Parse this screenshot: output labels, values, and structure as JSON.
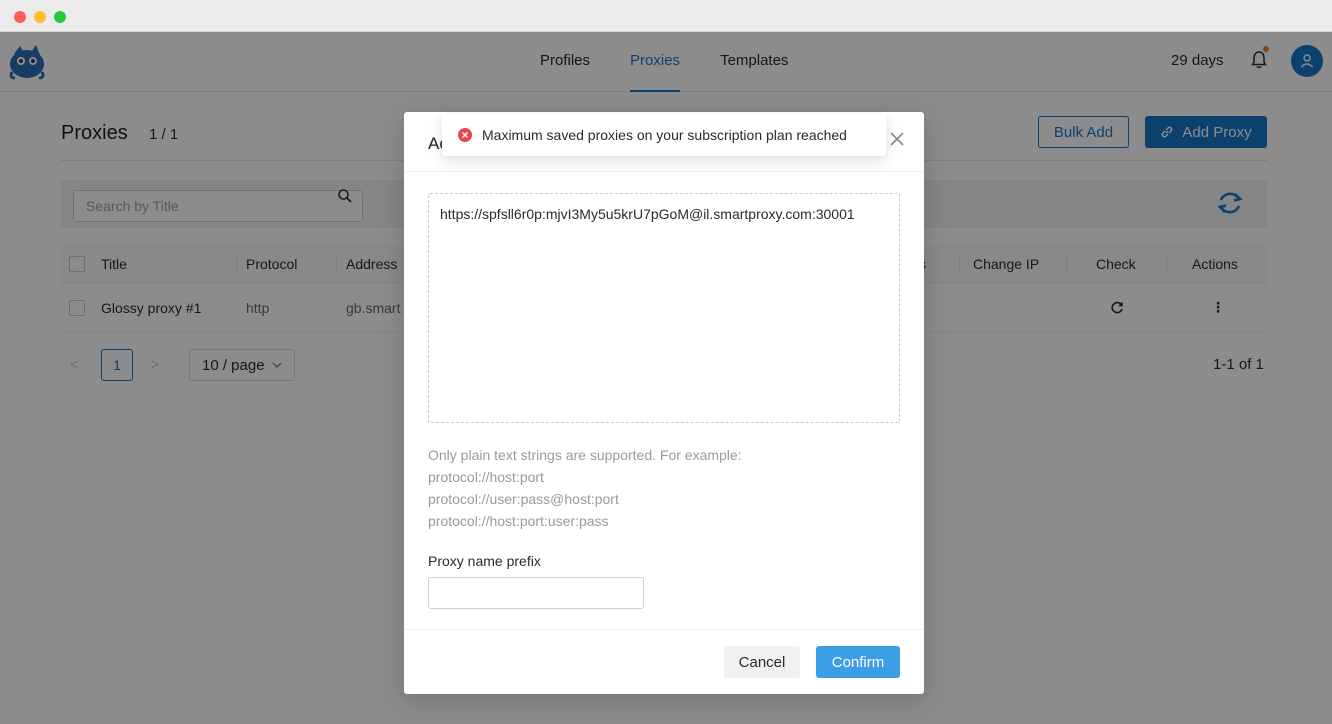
{
  "app": {
    "nav": {
      "links": [
        {
          "label": "Profiles"
        },
        {
          "label": "Proxies"
        },
        {
          "label": "Templates"
        }
      ],
      "subscription_days": "29 days"
    },
    "page": {
      "title": "Proxies",
      "count": "1 / 1",
      "bulk_add_label": "Bulk Add",
      "add_proxy_label": "Add Proxy",
      "search_placeholder": "Search by Title"
    },
    "table": {
      "headers": {
        "title": "Title",
        "protocol": "Protocol",
        "address": "Address",
        "hidden_col_tail": "s",
        "change_ip": "Change IP",
        "check": "Check",
        "actions": "Actions"
      },
      "rows": [
        {
          "title": "Glossy proxy #1",
          "protocol": "http",
          "address": "gb.smart",
          "actions": "⋮"
        }
      ]
    },
    "pagination": {
      "prev": "<",
      "current_page": "1",
      "next": ">",
      "page_size": "10 / page",
      "range": "1-1 of 1"
    }
  },
  "modal": {
    "title_visible": "Ac",
    "textarea_value": "https://spfsll6r0p:mjvI3My5u5krU7pGoM@il.smartproxy.com:30001",
    "hint_lines": [
      "Only plain text strings are supported. For example:",
      "protocol://host:port",
      "protocol://user:pass@host:port",
      "protocol://host:port:user:pass"
    ],
    "prefix_label": "Proxy name prefix",
    "prefix_value": "",
    "cancel_label": "Cancel",
    "confirm_label": "Confirm"
  },
  "toast": {
    "message": "Maximum saved proxies on your subscription plan reached",
    "icon": "error-circle-icon",
    "color": "#e5484d"
  },
  "colors": {
    "accent": "#1677c9",
    "confirm": "#3d9ee8"
  }
}
